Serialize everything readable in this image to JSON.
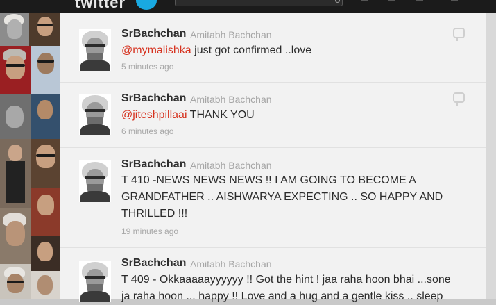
{
  "header": {
    "logo_label": "twitter"
  },
  "tweets": [
    {
      "handle": "SrBachchan",
      "name": "Amitabh Bachchan",
      "mention": "@mymalishka",
      "text": " just got confirmed ..love",
      "time": "5 minutes ago"
    },
    {
      "handle": "SrBachchan",
      "name": "Amitabh Bachchan",
      "mention": "@jiteshpillaai",
      "text": " THANK YOU",
      "time": "6 minutes ago"
    },
    {
      "handle": "SrBachchan",
      "name": "Amitabh Bachchan",
      "line1": "T 410 -NEWS NEWS NEWS !! I AM GOING TO BECOME A",
      "line2": "GRANDFATHER .. AISHWARYA EXPECTING .. SO HAPPY AND",
      "line3": "THRILLED !!!",
      "time": "19 minutes ago"
    },
    {
      "handle": "SrBachchan",
      "name": "Amitabh Bachchan",
      "line1": "T 409 - Okkaaaaayyyyyy !! Got the hint ! jaa raha hoon bhai ...sone",
      "line2": "ja raha hoon ... happy !! Love and a hug and a gentle kiss .. sleep"
    }
  ],
  "colors": {
    "mention": "#d6321f",
    "logo_bird": "#19a9e1"
  }
}
